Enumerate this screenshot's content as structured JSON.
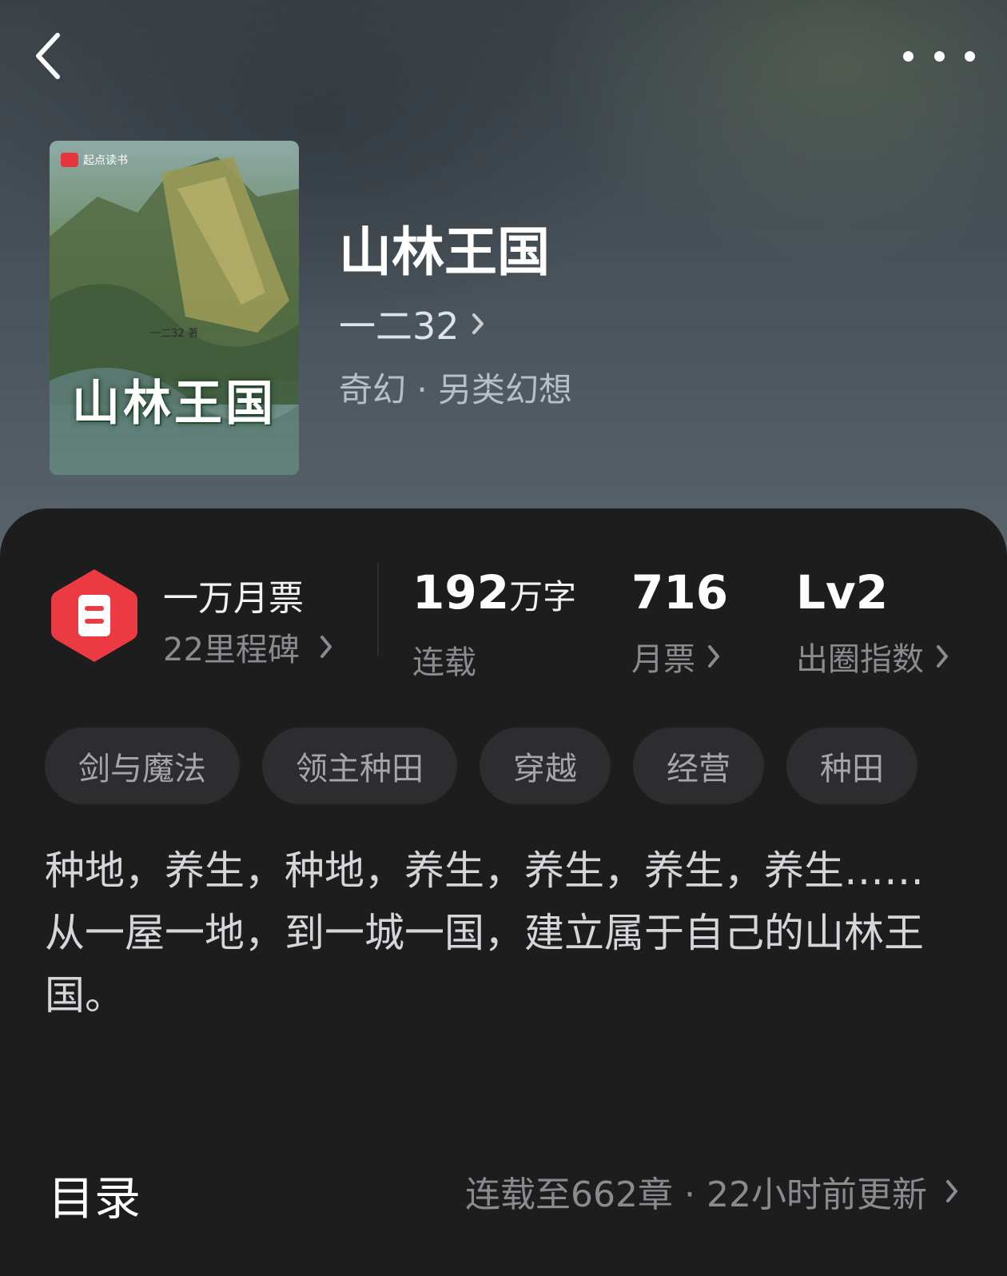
{
  "header": {
    "back_icon": "chevron-left-icon",
    "more_icon": "more-dots-icon"
  },
  "cover": {
    "brand": "起点读书",
    "title": "山林王国",
    "author": "一二32 著"
  },
  "book": {
    "title": "山林王国",
    "author": "一二32",
    "genre": "奇幻 · 另类幻想"
  },
  "badge": {
    "title": "一万月票",
    "subtitle": "22里程碑",
    "color": "#ec3a43"
  },
  "stats": {
    "words": {
      "value": "192",
      "unit": "万字",
      "label": "连载"
    },
    "tickets": {
      "value": "716",
      "label": "月票"
    },
    "level": {
      "value": "Lv2",
      "label": "出圈指数"
    }
  },
  "tags": [
    "剑与魔法",
    "领主种田",
    "穿越",
    "经营",
    "种田"
  ],
  "description": {
    "line1": "种地，养生，种地，养生，养生，养生，养生……",
    "line2": "从一屋一地，到一城一国，建立属于自己的山林王国。"
  },
  "toc": {
    "title": "目录",
    "info": "连载至662章 · 22小时前更新"
  }
}
